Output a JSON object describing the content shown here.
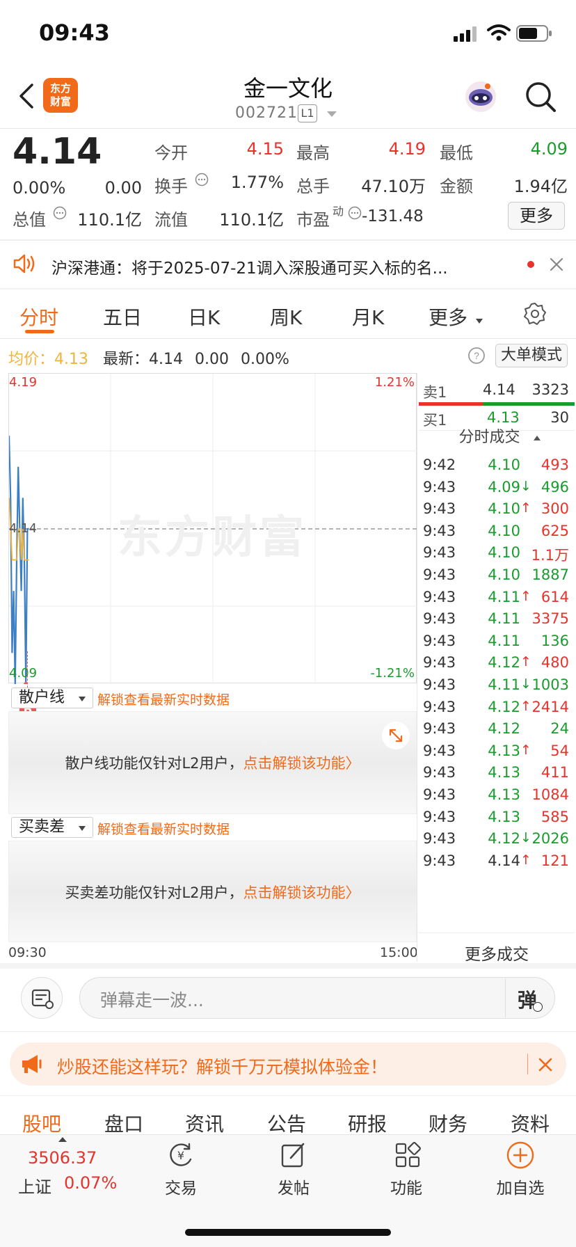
{
  "status_bar": {
    "time": "09:43"
  },
  "header": {
    "logo_line1": "东方",
    "logo_line2": "财富",
    "title": "金一文化",
    "code": "002721",
    "level_badge": "L1"
  },
  "quote": {
    "price": "4.14",
    "change_pct": "0.00%",
    "change": "0.00",
    "open_label": "今开",
    "open": "4.15",
    "high_label": "最高",
    "high": "4.19",
    "low_label": "最低",
    "low": "4.09",
    "turnover_label": "换手",
    "turnover": "1.77%",
    "volume_label": "总手",
    "volume": "47.10万",
    "amount_label": "金额",
    "amount": "1.94亿",
    "mktcap_label": "总值",
    "mktcap": "110.1亿",
    "float_label": "流值",
    "float": "110.1亿",
    "pe_label": "市盈",
    "pe_sup": "动",
    "pe": "-131.48",
    "more_label": "更多"
  },
  "notice": {
    "text": "沪深港通：将于2025-07-21调入深股通可买入标的名..."
  },
  "tabs": [
    "分时",
    "五日",
    "日K",
    "周K",
    "月K",
    "更多"
  ],
  "info_line": {
    "avg_label": "均价：",
    "avg": "4.13",
    "latest_label": "最新：",
    "latest": "4.14",
    "chg": "0.00",
    "pct": "0.00%",
    "big_order_mode": "大单模式"
  },
  "chart": {
    "watermark": "东方财富",
    "y_max_label": "4.19",
    "y_mid_label": "4.14",
    "y_min_label": "4.09",
    "pct_max_label": "1.21%",
    "pct_min_label": "-1.21%",
    "x_start": "09:30",
    "x_end": "15:00",
    "b_marker": "B"
  },
  "chart_data": {
    "type": "line",
    "ylim": [
      4.09,
      4.19
    ],
    "reference_price": 4.14,
    "series": [
      {
        "values": [
          4.17,
          4.15,
          4.1,
          4.12,
          4.09,
          4.13,
          4.16,
          4.14,
          4.12,
          4.15,
          4.13,
          4.09,
          4.14,
          4.14
        ]
      },
      {
        "values": [
          4.15,
          4.14,
          4.13,
          4.13,
          4.13,
          4.13,
          4.14,
          4.14,
          4.13,
          4.14,
          4.13,
          4.13,
          4.13,
          4.13
        ]
      }
    ]
  },
  "order_book": {
    "sell1_label": "卖1",
    "sell1_price": "4.14",
    "sell1_vol": "3323",
    "buy1_label": "买1",
    "buy1_price": "4.13",
    "buy1_vol": "30",
    "trades_header": "分时成交"
  },
  "trades": [
    {
      "time": "9:42",
      "price": "4.10",
      "arrow": "",
      "vol": "493",
      "pc": "green",
      "vc": "red"
    },
    {
      "time": "9:43",
      "price": "4.09",
      "arrow": "↓",
      "vol": "496",
      "pc": "green",
      "vc": "green"
    },
    {
      "time": "9:43",
      "price": "4.10",
      "arrow": "↑",
      "vol": "300",
      "pc": "green",
      "vc": "red"
    },
    {
      "time": "9:43",
      "price": "4.10",
      "arrow": "",
      "vol": "625",
      "pc": "green",
      "vc": "red"
    },
    {
      "time": "9:43",
      "price": "4.10",
      "arrow": "",
      "vol": "1.1万",
      "pc": "green",
      "vc": "red"
    },
    {
      "time": "9:43",
      "price": "4.10",
      "arrow": "",
      "vol": "1887",
      "pc": "green",
      "vc": "green"
    },
    {
      "time": "9:43",
      "price": "4.11",
      "arrow": "↑",
      "vol": "614",
      "pc": "green",
      "vc": "red"
    },
    {
      "time": "9:43",
      "price": "4.11",
      "arrow": "",
      "vol": "3375",
      "pc": "green",
      "vc": "red"
    },
    {
      "time": "9:43",
      "price": "4.11",
      "arrow": "",
      "vol": "136",
      "pc": "green",
      "vc": "green"
    },
    {
      "time": "9:43",
      "price": "4.12",
      "arrow": "↑",
      "vol": "480",
      "pc": "green",
      "vc": "red"
    },
    {
      "time": "9:43",
      "price": "4.11",
      "arrow": "↓",
      "vol": "1003",
      "pc": "green",
      "vc": "green"
    },
    {
      "time": "9:43",
      "price": "4.12",
      "arrow": "↑",
      "vol": "2414",
      "pc": "green",
      "vc": "red"
    },
    {
      "time": "9:43",
      "price": "4.12",
      "arrow": "",
      "vol": "24",
      "pc": "green",
      "vc": "green"
    },
    {
      "time": "9:43",
      "price": "4.13",
      "arrow": "↑",
      "vol": "54",
      "pc": "green",
      "vc": "red"
    },
    {
      "time": "9:43",
      "price": "4.13",
      "arrow": "",
      "vol": "411",
      "pc": "green",
      "vc": "red"
    },
    {
      "time": "9:43",
      "price": "4.13",
      "arrow": "",
      "vol": "1084",
      "pc": "green",
      "vc": "red"
    },
    {
      "time": "9:43",
      "price": "4.13",
      "arrow": "",
      "vol": "585",
      "pc": "green",
      "vc": "red"
    },
    {
      "time": "9:43",
      "price": "4.12",
      "arrow": "↓",
      "vol": "2026",
      "pc": "green",
      "vc": "green"
    },
    {
      "time": "9:43",
      "price": "4.14",
      "arrow": "↑",
      "vol": "121",
      "pc": "dark",
      "vc": "red"
    }
  ],
  "more_trades": "更多成交",
  "panels": {
    "retail": {
      "select": "散户线",
      "unlock": "解锁查看最新实时数据",
      "msg": "散户线功能仅针对L2用户，",
      "link": "点击解锁该功能〉"
    },
    "spread": {
      "select": "买卖差",
      "unlock": "解锁查看最新实时数据",
      "msg": "买卖差功能仅针对L2用户，",
      "link": "点击解锁该功能〉"
    }
  },
  "comment": {
    "placeholder": "弹幕走一波...",
    "danmu_label": "弹"
  },
  "promo": {
    "text": "炒股还能这样玩？解锁千万元模拟体验金！"
  },
  "bottom_tabs": [
    "股吧",
    "盘口",
    "资讯",
    "公告",
    "研报",
    "财务",
    "资料"
  ],
  "bottom_bar": {
    "index_value": "3506.37",
    "index_name": "上证",
    "index_pct": "0.07%",
    "trade": "交易",
    "post": "发帖",
    "functions": "功能",
    "add_watch": "加自选"
  },
  "colors": {
    "accent": "#f06a1a",
    "up": "#e8322c",
    "down": "#1a9b2e",
    "price_line": "#3d7fc4",
    "avg_line": "#f0b43c"
  }
}
